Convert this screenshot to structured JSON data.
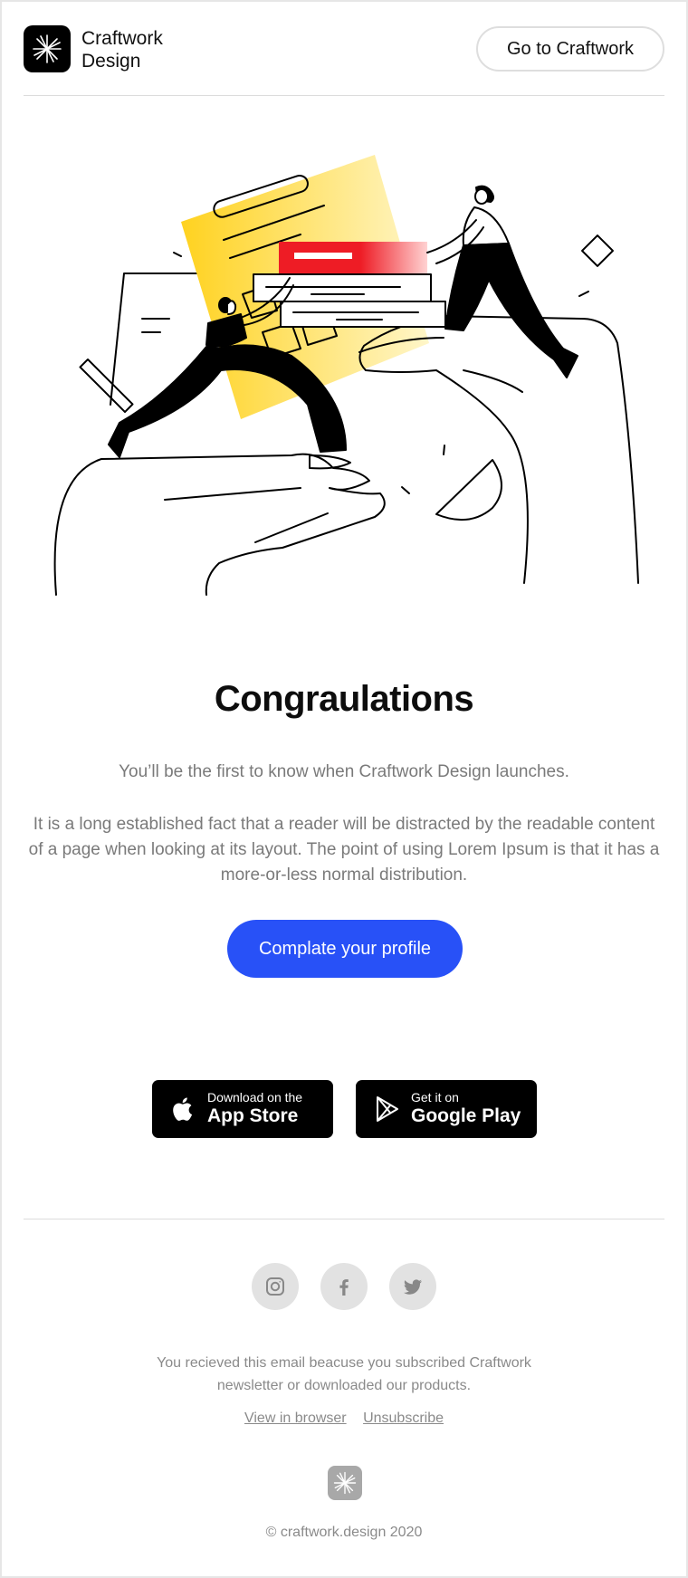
{
  "brand": {
    "name": "Craftwork\nDesign",
    "accent": "#2851f7"
  },
  "header": {
    "cta_label": "Go to Craftwork"
  },
  "hero": {
    "illustration": "people-stacking-books-on-hands"
  },
  "main": {
    "title": "Congraulations",
    "lead": "You’ll be the first to know when Craftwork Design launches.",
    "body": "It is a long established fact that a reader will be distracted by the readable content of a page when looking at its layout. The point of using Lorem Ipsum is that it has a more-or-less normal distribution.",
    "cta_label": "Complate your profile"
  },
  "stores": {
    "apple": {
      "small": "Download on the",
      "big": "App Store",
      "icon": "apple-icon"
    },
    "google": {
      "small": "Get it on",
      "big": "Google Play",
      "icon": "play-icon"
    }
  },
  "footer": {
    "social": [
      "instagram-icon",
      "facebook-icon",
      "twitter-icon"
    ],
    "notice": "You recieved this email beacuse you subscribed Craftwork\nnewsletter or downloaded our products.",
    "view_in_browser": "View in browser",
    "unsubscribe": "Unsubscribe",
    "copyright": "© craftwork.design 2020"
  }
}
